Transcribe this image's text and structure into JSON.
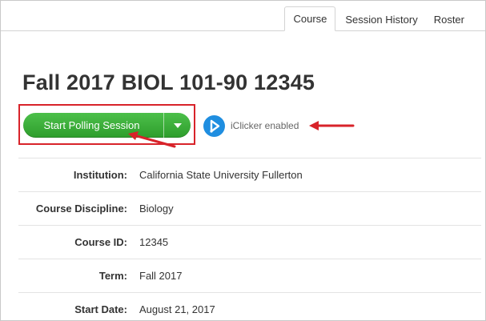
{
  "tabs": [
    {
      "label": "Course",
      "active": true
    },
    {
      "label": "Session History",
      "active": false
    },
    {
      "label": "Roster",
      "active": false
    }
  ],
  "course": {
    "title": "Fall 2017 BIOL 101-90 12345"
  },
  "actions": {
    "start_label": "Start Polling Session",
    "dropdown_icon": "caret-down",
    "start_color": "#3aad38"
  },
  "iclicker": {
    "label": "iClicker enabled",
    "icon": "iclicker-logo",
    "color": "#1f8ee0"
  },
  "details": [
    {
      "label": "Institution:",
      "value": "California State University Fullerton"
    },
    {
      "label": "Course Discipline:",
      "value": "Biology"
    },
    {
      "label": "Course ID:",
      "value": "12345"
    },
    {
      "label": "Term:",
      "value": "Fall 2017"
    },
    {
      "label": "Start Date:",
      "value": "August 21, 2017"
    }
  ],
  "annotation_color": "#d8232a"
}
